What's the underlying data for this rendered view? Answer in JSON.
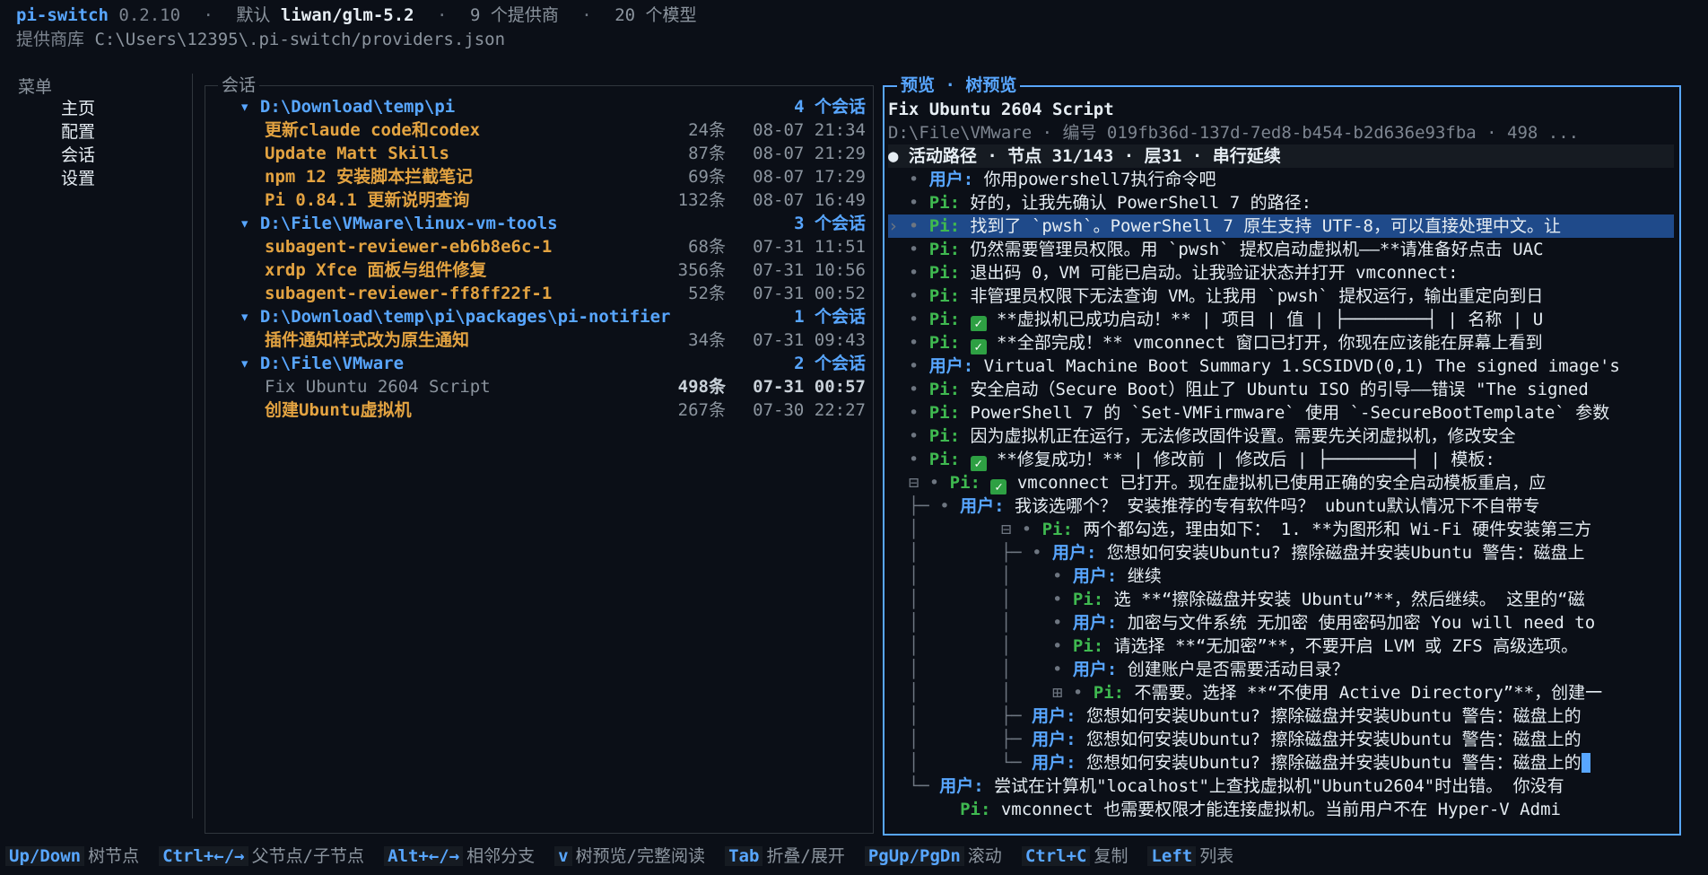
{
  "header": {
    "app": "pi-switch",
    "version": "0.2.10",
    "default_label": "默认",
    "default_model": "liwan/glm-5.2",
    "providers": "9 个提供商",
    "models": "20 个模型",
    "repo_label": "提供商库",
    "repo_path": "C:\\Users\\12395\\.pi-switch/providers.json"
  },
  "menu": {
    "title": "菜单",
    "items": [
      "主页",
      "配置",
      "会话",
      "设置"
    ]
  },
  "sessions": {
    "title": "会话",
    "groups": [
      {
        "folder": "D:\\Download\\temp\\pi",
        "count": "4 个会话",
        "items": [
          {
            "name": "更新claude code和codex",
            "num": "24条",
            "date": "08-07 21:34"
          },
          {
            "name": "Update Matt Skills",
            "num": "87条",
            "date": "08-07 21:29"
          },
          {
            "name": "npm 12 安装脚本拦截笔记",
            "num": "69条",
            "date": "08-07 17:29"
          },
          {
            "name": "Pi 0.84.1 更新说明查询",
            "num": "132条",
            "date": "08-07 16:49"
          }
        ]
      },
      {
        "folder": "D:\\File\\VMware\\linux-vm-tools",
        "count": "3 个会话",
        "items": [
          {
            "name": "subagent-reviewer-eb6b8e6c-1",
            "num": "68条",
            "date": "07-31 11:51"
          },
          {
            "name": "xrdp Xfce 面板与组件修复",
            "num": "356条",
            "date": "07-31 10:56"
          },
          {
            "name": "subagent-reviewer-ff8ff22f-1",
            "num": "52条",
            "date": "07-31 00:52"
          }
        ]
      },
      {
        "folder": "D:\\Download\\temp\\pi\\packages\\pi-notifier",
        "count": "1 个会话",
        "items": [
          {
            "name": "插件通知样式改为原生通知",
            "num": "34条",
            "date": "07-31 09:43"
          }
        ]
      },
      {
        "folder": "D:\\File\\VMware",
        "count": "2 个会话",
        "items": [
          {
            "name": "Fix Ubuntu 2604 Script",
            "num": "498条",
            "date": "07-31 00:57"
          },
          {
            "name": "创建Ubuntu虚拟机",
            "num": "267条",
            "date": "07-30 22:27"
          }
        ]
      }
    ]
  },
  "preview": {
    "title": "预览 · 树预览",
    "session_title": "Fix Ubuntu 2604 Script",
    "meta": "D:\\File\\VMware  ·  编号 019fb36d-137d-7ed8-b454-b2d636e93fba  ·  498 ...",
    "status": "● 活动路径  ·  节点 31/143  ·  层31  ·  串行延续",
    "user_label": "用户:",
    "pi_label": "Pi:",
    "lines": [
      {
        "prefix": "  • ",
        "role": "user",
        "text": " 你用powershell7执行命令吧"
      },
      {
        "prefix": "  • ",
        "role": "pi",
        "text": " 好的，让我先确认 PowerShell 7 的路径:"
      },
      {
        "prefix": "› • ",
        "role": "pi",
        "text": " 找到了 `pwsh`。PowerShell 7 原生支持 UTF-8，可以直接处理中文。让"
      },
      {
        "prefix": "  • ",
        "role": "pi",
        "text": " 仍然需要管理员权限。用 `pwsh` 提权启动虚拟机——**请准备好点击 UAC"
      },
      {
        "prefix": "  • ",
        "role": "pi",
        "text": " 退出码 0，VM 可能已启动。让我验证状态并打开 vmconnect:"
      },
      {
        "prefix": "  • ",
        "role": "pi",
        "text": " 非管理员权限下无法查询 VM。让我用 `pwsh` 提权运行，输出重定向到日"
      },
      {
        "prefix": "  • ",
        "role": "pi",
        "check": true,
        "text": " **虚拟机已成功启动！** | 项目 | 值 | ├────────┤ | 名称 | U"
      },
      {
        "prefix": "  • ",
        "role": "pi",
        "check": true,
        "text": " **全部完成！** vmconnect 窗口已打开，你现在应该能在屏幕上看到"
      },
      {
        "prefix": "  • ",
        "role": "user",
        "text": " Virtual Machine Boot Summary 1.SCSIDVD(0,1) The signed image's"
      },
      {
        "prefix": "  • ",
        "role": "pi",
        "text": " 安全启动（Secure Boot）阻止了 Ubuntu ISO 的引导——错误 \"The signed"
      },
      {
        "prefix": "  • ",
        "role": "pi",
        "text": " PowerShell 7 的 `Set-VMFirmware` 使用 `-SecureBootTemplate` 参数"
      },
      {
        "prefix": "  • ",
        "role": "pi",
        "text": " 因为虚拟机正在运行，无法修改固件设置。需要先关闭虚拟机，修改安全"
      },
      {
        "prefix": "  • ",
        "role": "pi",
        "check": true,
        "text": " **修复成功！** | 修改前 | 修改后 | ├────────┤ | 模板:"
      },
      {
        "prefix": "  ⊟ • ",
        "role": "pi",
        "check": true,
        "text": " vmconnect 已打开。现在虚拟机已使用正确的安全启动模板重启，应"
      },
      {
        "prefix": "  ├─ • ",
        "role": "user",
        "text": " 我该选哪个？ 安装推荐的专有软件吗？ ubuntu默认情况下不自带专"
      },
      {
        "prefix": "  │        ⊟ • ",
        "role": "pi",
        "text": " 两个都勾选，理由如下： 1. **为图形和 Wi-Fi 硬件安装第三方"
      },
      {
        "prefix": "  │        ├─ • ",
        "role": "user",
        "text": " 您想如何安装Ubuntu? 擦除磁盘并安装Ubuntu 警告：磁盘上"
      },
      {
        "prefix": "  │        │    • ",
        "role": "user",
        "text": " 继续"
      },
      {
        "prefix": "  │        │    • ",
        "role": "pi",
        "text": " 选 **“擦除磁盘并安装 Ubuntu”**，然后继续。 这里的“磁"
      },
      {
        "prefix": "  │        │    • ",
        "role": "user",
        "text": " 加密与文件系统 无加密 使用密码加密 You will need to"
      },
      {
        "prefix": "  │        │    • ",
        "role": "pi",
        "text": " 请选择 **“无加密”**，不要开启 LVM 或 ZFS 高级选项。"
      },
      {
        "prefix": "  │        │    • ",
        "role": "user",
        "text": " 创建账户是否需要活动目录？"
      },
      {
        "prefix": "  │        │    ⊞ • ",
        "role": "pi",
        "text": " 不需要。选择 **“不使用 Active Directory”**，创建一"
      },
      {
        "prefix": "  │        ├─ ",
        "role": "user",
        "text": " 您想如何安装Ubuntu? 擦除磁盘并安装Ubuntu 警告：磁盘上的"
      },
      {
        "prefix": "  │        ├─ ",
        "role": "user",
        "text": " 您想如何安装Ubuntu? 擦除磁盘并安装Ubuntu 警告：磁盘上的"
      },
      {
        "prefix": "  │        └─ ",
        "role": "user",
        "cursor": true,
        "text": " 您想如何安装Ubuntu? 擦除磁盘并安装Ubuntu 警告：磁盘上的"
      },
      {
        "prefix": "  └─ ",
        "role": "user",
        "text": " 尝试在计算机\"localhost\"上查找虚拟机\"Ubuntu2604\"时出错。 你没有"
      },
      {
        "prefix": "       ",
        "role": "pi",
        "text": " vmconnect 也需要权限才能连接虚拟机。当前用户不在 Hyper-V Admi"
      }
    ]
  },
  "footer": [
    {
      "key": "Up/Down",
      "desc": "树节点"
    },
    {
      "key": "Ctrl+←/→",
      "desc": "父节点/子节点"
    },
    {
      "key": "Alt+←/→",
      "desc": "相邻分支"
    },
    {
      "key": "v",
      "desc": "树预览/完整阅读"
    },
    {
      "key": "Tab",
      "desc": "折叠/展开"
    },
    {
      "key": "PgUp/PgDn",
      "desc": "滚动"
    },
    {
      "key": "Ctrl+C",
      "desc": "复制"
    },
    {
      "key": "Left",
      "desc": "列表"
    }
  ]
}
